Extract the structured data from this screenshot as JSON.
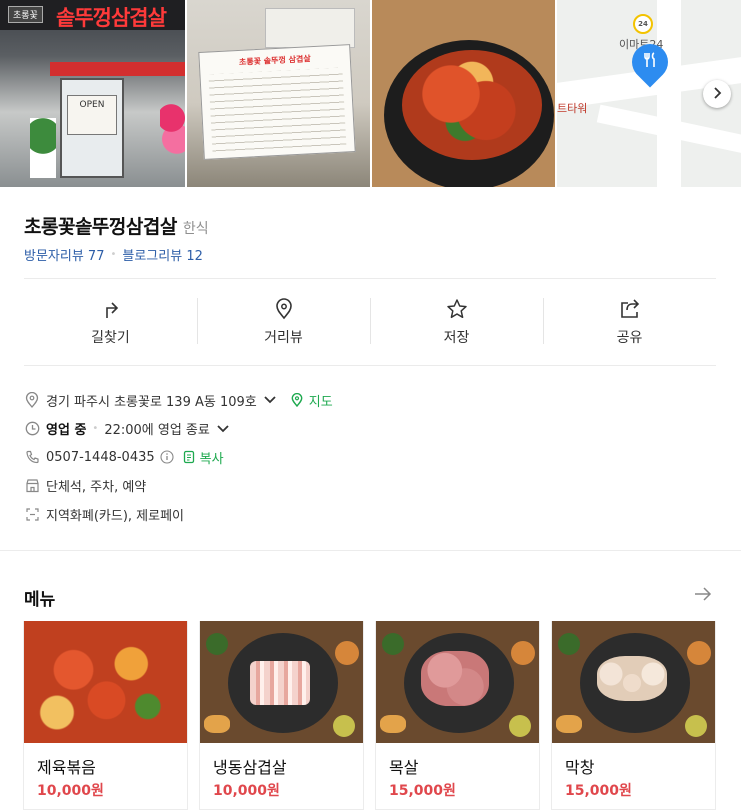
{
  "photos": {
    "sign_text": "솥뚜껑삼겹살",
    "sign_small": "초롱꽃",
    "open_sign": "OPEN",
    "menu_board_title": "초롱꽃 솥뚜껑 삼겹살",
    "map": {
      "store_label": "이마트24",
      "store_badge": "24",
      "tower_label": "트타워"
    }
  },
  "place": {
    "name": "초롱꽃솥뚜껑삼겹살",
    "category": "한식",
    "visitor_review": "방문자리뷰 77",
    "blog_review": "블로그리뷰 12"
  },
  "actions": [
    {
      "label": "길찾기",
      "icon": "directions-icon"
    },
    {
      "label": "거리뷰",
      "icon": "street-view-icon"
    },
    {
      "label": "저장",
      "icon": "star-icon"
    },
    {
      "label": "공유",
      "icon": "share-icon"
    }
  ],
  "info": {
    "address": "경기 파주시 초롱꽃로 139 A동 109호",
    "map_link": "지도",
    "status": "영업 중",
    "hours": "22:00에 영업 종료",
    "phone": "0507-1448-0435",
    "copy": "복사",
    "facilities": "단체석, 주차, 예약",
    "payment": "지역화폐(카드), 제로페이"
  },
  "menu": {
    "heading": "메뉴",
    "items": [
      {
        "name": "제육볶음",
        "price": "10,000원"
      },
      {
        "name": "냉동삼겹살",
        "price": "10,000원"
      },
      {
        "name": "목살",
        "price": "15,000원"
      },
      {
        "name": "막창",
        "price": "15,000원"
      }
    ]
  },
  "colors": {
    "link_blue": "#2d5ea8",
    "naver_green": "#1ea94f",
    "price_red": "#e0474c",
    "pin_blue": "#2d8cf0"
  }
}
